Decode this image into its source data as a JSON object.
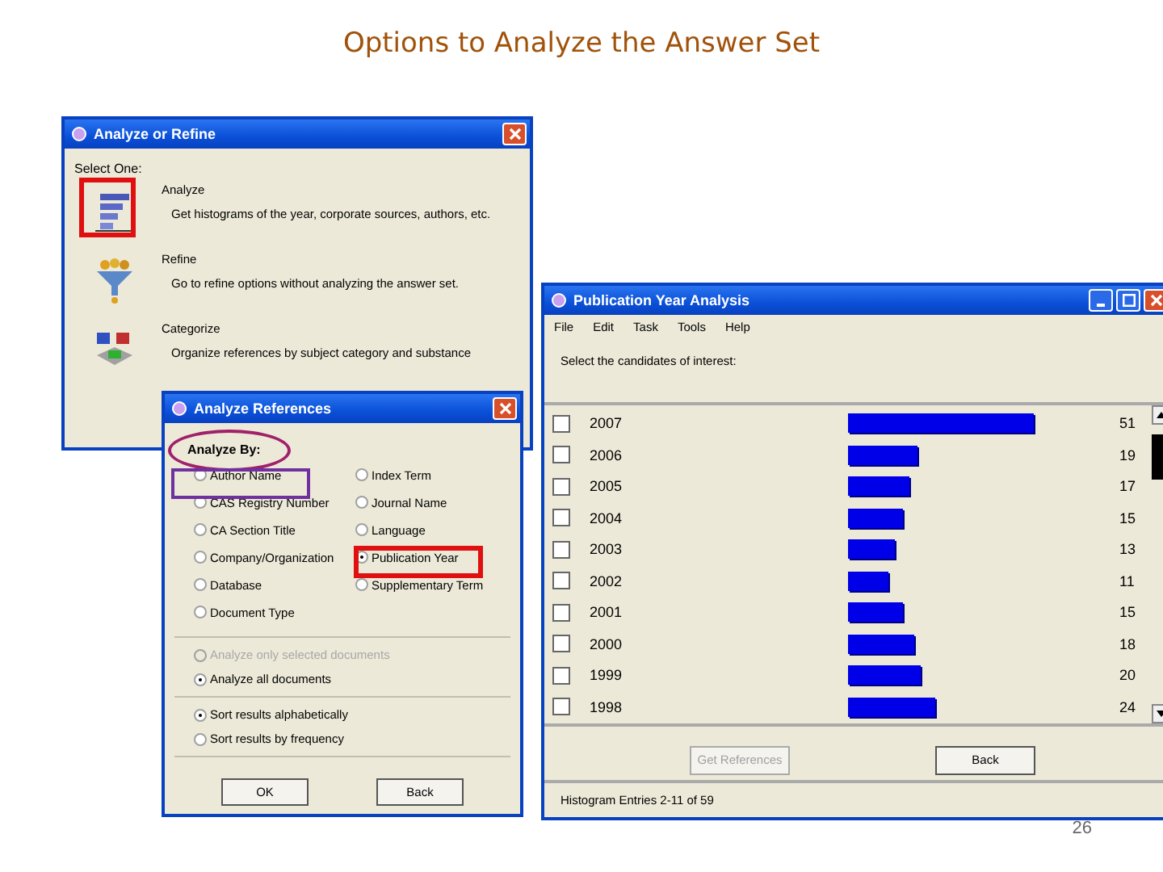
{
  "slide": {
    "title": "Options to Analyze the Answer Set",
    "page_number": "26"
  },
  "analyze_or_refine": {
    "title": "Analyze or Refine",
    "prompt": "Select One:",
    "choices": [
      {
        "kind": "histogram",
        "label": "Analyze",
        "description": "Get histograms of the year, corporate sources, authors, etc."
      },
      {
        "kind": "funnel",
        "label": "Refine",
        "description": "Go to refine options without analyzing the answer set."
      },
      {
        "kind": "categories",
        "label": "Categorize",
        "description": "Organize references by subject category and substance"
      }
    ]
  },
  "analyze_references": {
    "title": "Analyze References",
    "heading": "Analyze By:",
    "options": [
      {
        "label": "Author Name",
        "selected": false
      },
      {
        "label": "Index Term",
        "selected": false
      },
      {
        "label": "CAS Registry Number",
        "selected": false
      },
      {
        "label": "Journal Name",
        "selected": false
      },
      {
        "label": "CA Section Title",
        "selected": false
      },
      {
        "label": "Language",
        "selected": false
      },
      {
        "label": "Company/Organization",
        "selected": false
      },
      {
        "label": "Publication Year",
        "selected": true
      },
      {
        "label": "Database",
        "selected": false
      },
      {
        "label": "Supplementary Term",
        "selected": false
      },
      {
        "label": "Document Type",
        "selected": false
      }
    ],
    "scope": [
      {
        "label": "Analyze only selected documents",
        "selected": false,
        "disabled": true
      },
      {
        "label": "Analyze all documents",
        "selected": true,
        "disabled": false
      }
    ],
    "sort": [
      {
        "label": "Sort results alphabetically",
        "selected": true
      },
      {
        "label": "Sort results by frequency",
        "selected": false
      }
    ],
    "buttons": [
      "OK",
      "Back"
    ]
  },
  "publication_year_analysis": {
    "title": "Publication Year Analysis",
    "menu": [
      "File",
      "Edit",
      "Task",
      "Tools",
      "Help"
    ],
    "prompt": "Select the candidates of interest:",
    "rows": [
      {
        "label": "2007",
        "checked": false,
        "count": "51"
      },
      {
        "label": "2006",
        "checked": false,
        "count": "19"
      },
      {
        "label": "2005",
        "checked": false,
        "count": "17"
      },
      {
        "label": "2004",
        "checked": false,
        "count": "15"
      },
      {
        "label": "2003",
        "checked": false,
        "count": "13"
      },
      {
        "label": "2002",
        "checked": false,
        "count": "11"
      },
      {
        "label": "2001",
        "checked": false,
        "count": "15"
      },
      {
        "label": "2000",
        "checked": false,
        "count": "18"
      },
      {
        "label": "1999",
        "checked": false,
        "count": "20"
      },
      {
        "label": "1998",
        "checked": false,
        "count": "24"
      }
    ],
    "buttons": [
      {
        "label": "Get References",
        "disabled": true
      },
      {
        "label": "Back",
        "disabled": false
      }
    ],
    "status": "Histogram Entries 2-11 of 59"
  }
}
